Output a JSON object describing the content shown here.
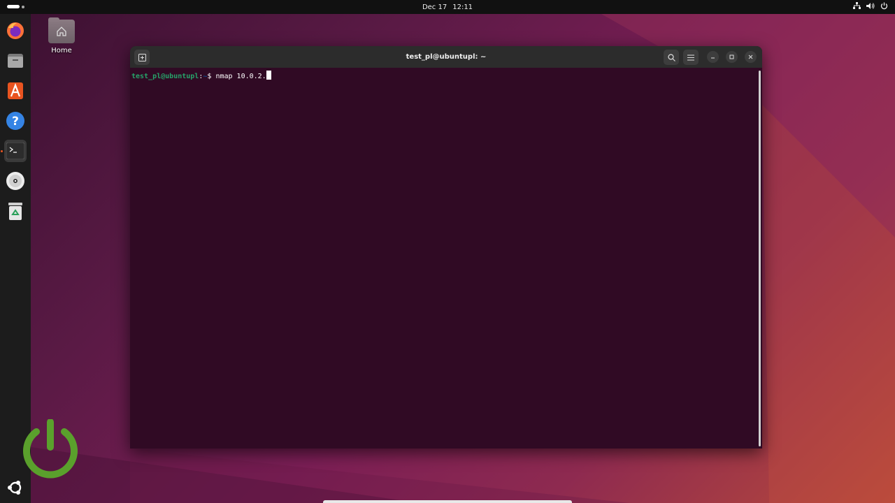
{
  "topbar": {
    "date": "Dec 17",
    "time": "12:11",
    "tray_icons": [
      "network-icon",
      "volume-icon",
      "power-icon"
    ]
  },
  "dock": {
    "items": [
      {
        "name": "firefox",
        "icon": "firefox-icon"
      },
      {
        "name": "files",
        "icon": "files-icon"
      },
      {
        "name": "app-center",
        "icon": "app-center-icon"
      },
      {
        "name": "help",
        "icon": "help-icon"
      },
      {
        "name": "terminal",
        "icon": "terminal-icon",
        "active": true
      },
      {
        "name": "disc",
        "icon": "disc-icon"
      },
      {
        "name": "trash",
        "icon": "trash-icon"
      }
    ],
    "show_apps_icon": "ubuntu-logo-icon"
  },
  "desktop": {
    "home_label": "Home"
  },
  "terminal": {
    "title": "test_pl@ubuntupl: ~",
    "prompt_user": "test_pl@ubuntupl",
    "prompt_sep": ":",
    "prompt_path": "~",
    "prompt_symbol": "$",
    "command": "nmap 10.0.2."
  },
  "colors": {
    "terminal_bg": "#300a24",
    "prompt_user": "#26a269",
    "prompt_path": "#12488b",
    "accent": "#e95420"
  }
}
